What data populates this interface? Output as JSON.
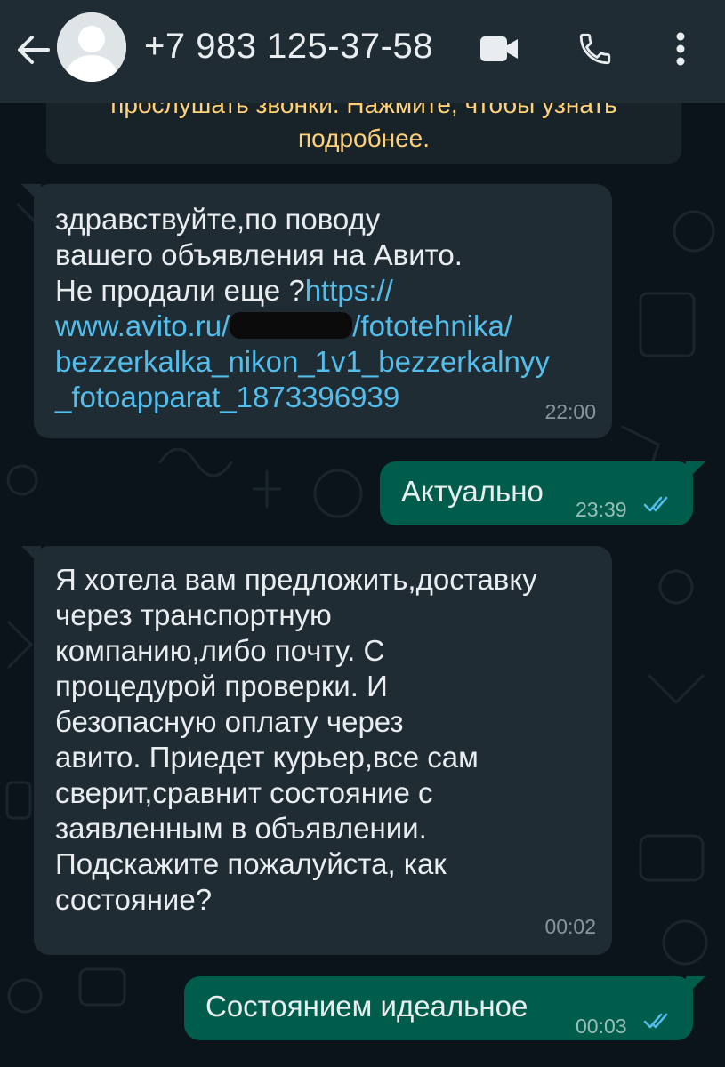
{
  "header": {
    "contact_name": "+7 983 125-37-58",
    "back_icon": "arrow-left-icon",
    "avatar_icon": "default-avatar-icon",
    "video_icon": "video-camera-icon",
    "call_icon": "phone-icon",
    "menu_icon": "more-vertical-icon"
  },
  "notice": {
    "line1": "прослушать звонки. Нажмите, чтобы узнать",
    "line2": "подробнее.",
    "color": "#ffd279"
  },
  "messages": [
    {
      "direction": "incoming",
      "lines": [
        "здравствуйте,по поводу",
        "вашего объявления на Авито.",
        "Не продали еще ?"
      ],
      "link_start": "https://",
      "link_part1": "www.avito.ru/",
      "link_part2": "/fototehnika/",
      "link_line3": "bezzerkalka_nikon_1v1_bezzerkalnyy",
      "link_line4": "_fotoapparat_1873396939",
      "time": "22:00"
    },
    {
      "direction": "outgoing",
      "text": "Актуально",
      "time": "23:39",
      "status": "read"
    },
    {
      "direction": "incoming",
      "text": "Я хотела вам предложить,доставку\nчерез транспортную\nкомпанию,либо почту. С\nпроцедурой проверки. И\nбезопасную оплату через\nавито. Приедет курьер,все сам\nсверит,сравнит состояние с\nзаявленным в объявлении.\nПодскажите пожалуйста, как\nсостояние?",
      "time": "00:02"
    },
    {
      "direction": "outgoing",
      "text": "Состоянием идеальное",
      "time": "00:03",
      "status": "read"
    }
  ],
  "colors": {
    "background": "#0b141a",
    "header": "#1f2c34",
    "incoming_bubble": "#202c33",
    "outgoing_bubble": "#005c4b",
    "link": "#53bdeb",
    "read_ticks": "#53bdeb"
  }
}
